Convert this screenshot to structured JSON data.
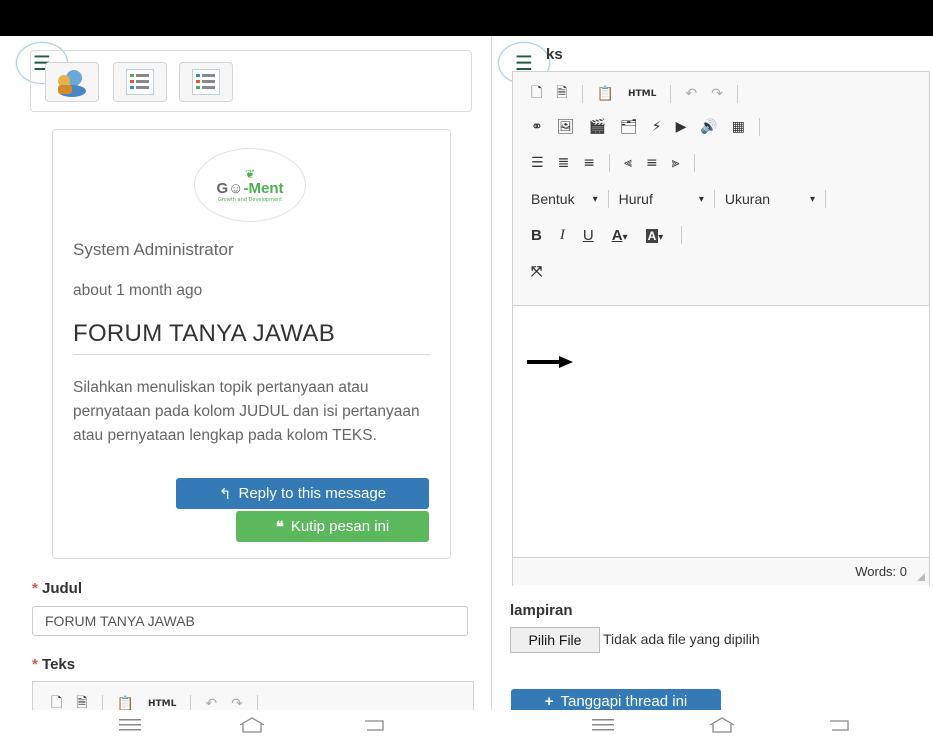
{
  "left": {
    "toolbar_icons": [
      "forum-user-icon",
      "list-icon",
      "list-icon"
    ],
    "post": {
      "logo_text_a": "G",
      "logo_text_b": "-Ment",
      "logo_subtitle": "Growth and Development",
      "author": "System Administrator",
      "time": "about 1 month ago",
      "title": "FORUM TANYA JAWAB",
      "body": "Silahkan menuliskan topik pertanyaan atau pernyataan pada kolom JUDUL dan isi pertanyaan atau pernyataan lengkap pada kolom TEKS.",
      "reply_label": "Reply to this message",
      "quote_label": "Kutip pesan ini"
    },
    "form": {
      "required_mark": "*",
      "judul_label": "Judul",
      "judul_value": "FORUM TANYA JAWAB",
      "teks_label": "Teks"
    }
  },
  "right": {
    "header_label": "ks",
    "dropdowns": {
      "format": "Bentuk",
      "font": "Huruf",
      "size": "Ukuran"
    },
    "bold": "B",
    "italic": "I",
    "underline": "U",
    "text_color": "A",
    "bg_color": "A",
    "words": "Words: 0",
    "lampiran_label": "lampiran",
    "file_button": "Pilih File",
    "file_status": "Tidak ada file yang dipilih",
    "submit_label": "Tanggapi thread ini"
  },
  "colors": {
    "primary": "#337ab7",
    "success": "#5cb85c",
    "required": "#d9534f",
    "brand_green": "#4caf50",
    "menu_green": "#1e5e3a"
  }
}
